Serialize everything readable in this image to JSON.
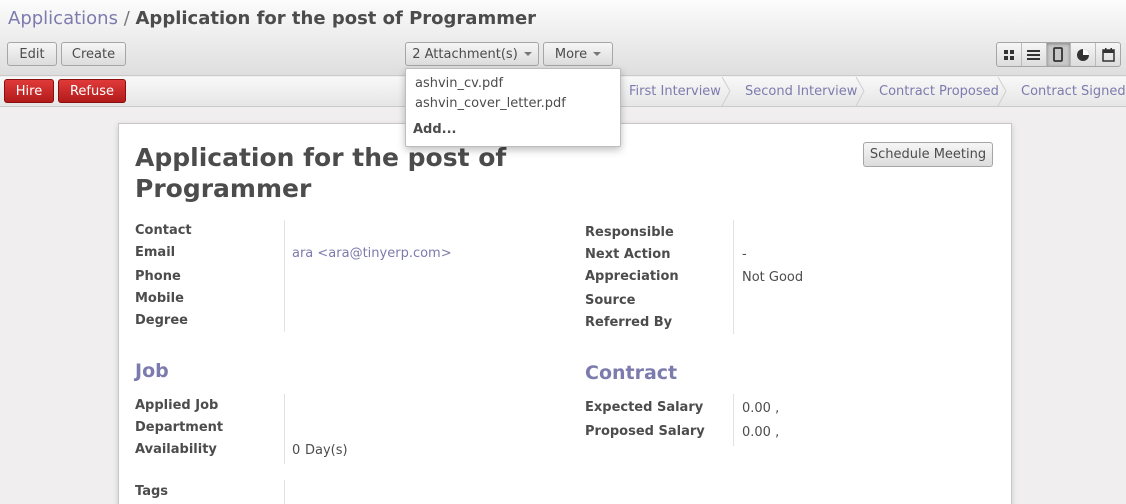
{
  "breadcrumb": {
    "parent": "Applications",
    "separator": "/",
    "current": "Application for the post of Programmer"
  },
  "toolbar": {
    "edit": "Edit",
    "create": "Create",
    "attachments": "2 Attachment(s)",
    "more": "More"
  },
  "view_switch": {
    "active": "form",
    "views": [
      "kanban",
      "list",
      "form",
      "graph",
      "calendar"
    ]
  },
  "actions": {
    "hire": "Hire",
    "refuse": "Refuse"
  },
  "stages": [
    "First Interview",
    "Second Interview",
    "Contract Proposed",
    "Contract Signed"
  ],
  "attachments_menu": {
    "items": [
      "ashvin_cv.pdf",
      "ashvin_cover_letter.pdf"
    ],
    "add": "Add..."
  },
  "form": {
    "title": "Application for the post of Programmer",
    "schedule_meeting": "Schedule Meeting",
    "left": {
      "contact": "Contact",
      "email": "Email",
      "email_value": "ara <ara@tinyerp.com>",
      "phone": "Phone",
      "mobile": "Mobile",
      "degree": "Degree"
    },
    "right": {
      "responsible": "Responsible",
      "next_action": "Next Action",
      "next_action_value": "-",
      "appreciation": "Appreciation",
      "appreciation_value": "Not Good",
      "source": "Source",
      "referred_by": "Referred By"
    },
    "job": {
      "heading": "Job",
      "applied_job": "Applied Job",
      "department": "Department",
      "availability": "Availability",
      "availability_value": "0",
      "availability_unit": "Day(s)"
    },
    "contract": {
      "heading": "Contract",
      "expected_salary": "Expected Salary",
      "expected_value": "0.00 ,",
      "proposed_salary": "Proposed Salary",
      "proposed_value": "0.00 ,"
    },
    "tags": "Tags"
  },
  "colors": {
    "accent": "#7c7bad",
    "danger": "#c02727"
  }
}
